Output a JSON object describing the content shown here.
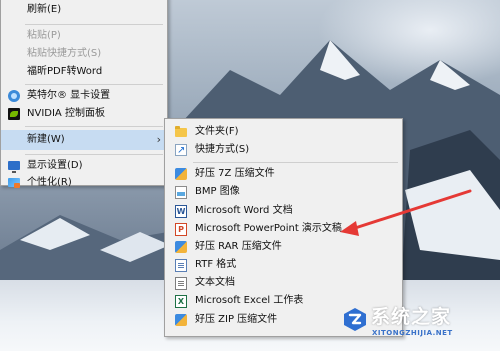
{
  "context_menu": {
    "items": [
      {
        "label": "刷新(E)",
        "enabled": true
      },
      {
        "label": "粘贴(P)",
        "enabled": false
      },
      {
        "label": "粘贴快捷方式(S)",
        "enabled": false
      },
      {
        "label": "福昕PDF转Word",
        "enabled": true
      },
      {
        "label": "英特尔® 显卡设置",
        "enabled": true,
        "icon": "intel-graphics-icon"
      },
      {
        "label": "NVIDIA 控制面板",
        "enabled": true,
        "icon": "nvidia-icon"
      },
      {
        "label": "新建(W)",
        "enabled": true,
        "has_submenu": true,
        "highlighted": true
      },
      {
        "label": "显示设置(D)",
        "enabled": true,
        "icon": "display-settings-icon"
      },
      {
        "label": "个性化(R)",
        "enabled": true,
        "icon": "personalize-icon"
      }
    ],
    "submenu_arrow": "›"
  },
  "new_submenu": {
    "items": [
      {
        "label": "文件夹(F)",
        "icon": "folder-icon"
      },
      {
        "label": "快捷方式(S)",
        "icon": "shortcut-icon"
      },
      {
        "label": "好压 7Z 压缩文件",
        "icon": "archive-icon"
      },
      {
        "label": "BMP 图像",
        "icon": "bitmap-image-icon"
      },
      {
        "label": "Microsoft Word 文档",
        "icon": "word-document-icon",
        "badge": "W"
      },
      {
        "label": "Microsoft PowerPoint 演示文稿",
        "icon": "powerpoint-icon",
        "badge": "P"
      },
      {
        "label": "好压 RAR 压缩文件",
        "icon": "archive-icon"
      },
      {
        "label": "RTF 格式",
        "icon": "rtf-document-icon"
      },
      {
        "label": "文本文档",
        "icon": "text-document-icon"
      },
      {
        "label": "Microsoft Excel 工作表",
        "icon": "excel-icon",
        "badge": "X"
      },
      {
        "label": "好压 ZIP 压缩文件",
        "icon": "archive-icon"
      }
    ]
  },
  "annotation": {
    "color": "#e53935",
    "points_to": "Microsoft PowerPoint 演示文稿"
  },
  "watermark": {
    "site_name": "系统之家",
    "url": "XITONGZHIJIA.NET"
  },
  "colors": {
    "menu_background": "#f0f0f0",
    "highlight": "#c7dcf2",
    "disabled_text": "#9a9a9a"
  }
}
